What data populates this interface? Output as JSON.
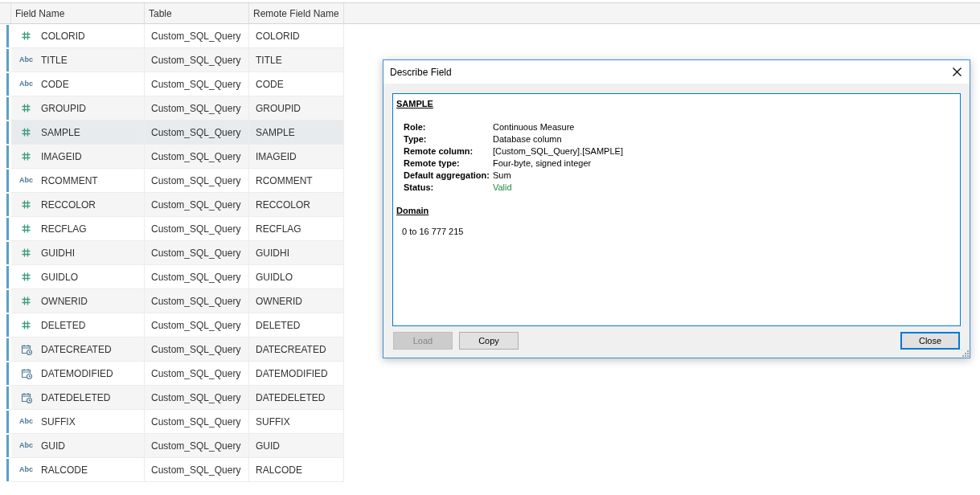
{
  "table": {
    "columns": [
      "Field Name",
      "Table",
      "Remote Field Name"
    ],
    "rows": [
      {
        "kind": "number",
        "name": "COLORID",
        "table": "Custom_SQL_Query",
        "remote": "COLORID",
        "selected": false
      },
      {
        "kind": "string",
        "type_label": "Abc",
        "name": "TITLE",
        "table": "Custom_SQL_Query",
        "remote": "TITLE",
        "selected": false
      },
      {
        "kind": "string",
        "type_label": "Abc",
        "name": "CODE",
        "table": "Custom_SQL_Query",
        "remote": "CODE",
        "selected": false
      },
      {
        "kind": "number",
        "name": "GROUPID",
        "table": "Custom_SQL_Query",
        "remote": "GROUPID",
        "selected": false
      },
      {
        "kind": "number",
        "name": "SAMPLE",
        "table": "Custom_SQL_Query",
        "remote": "SAMPLE",
        "selected": true
      },
      {
        "kind": "number",
        "name": "IMAGEID",
        "table": "Custom_SQL_Query",
        "remote": "IMAGEID",
        "selected": false
      },
      {
        "kind": "string",
        "type_label": "Abc",
        "name": "RCOMMENT",
        "table": "Custom_SQL_Query",
        "remote": "RCOMMENT",
        "selected": false
      },
      {
        "kind": "number",
        "name": "RECCOLOR",
        "table": "Custom_SQL_Query",
        "remote": "RECCOLOR",
        "selected": false
      },
      {
        "kind": "number",
        "name": "RECFLAG",
        "table": "Custom_SQL_Query",
        "remote": "RECFLAG",
        "selected": false
      },
      {
        "kind": "number",
        "name": "GUIDHI",
        "table": "Custom_SQL_Query",
        "remote": "GUIDHI",
        "selected": false
      },
      {
        "kind": "number",
        "name": "GUIDLO",
        "table": "Custom_SQL_Query",
        "remote": "GUIDLO",
        "selected": false
      },
      {
        "kind": "number",
        "name": "OWNERID",
        "table": "Custom_SQL_Query",
        "remote": "OWNERID",
        "selected": false
      },
      {
        "kind": "number",
        "name": "DELETED",
        "table": "Custom_SQL_Query",
        "remote": "DELETED",
        "selected": false
      },
      {
        "kind": "date",
        "name": "DATECREATED",
        "table": "Custom_SQL_Query",
        "remote": "DATECREATED",
        "selected": false
      },
      {
        "kind": "date",
        "name": "DATEMODIFIED",
        "table": "Custom_SQL_Query",
        "remote": "DATEMODIFIED",
        "selected": false
      },
      {
        "kind": "date",
        "name": "DATEDELETED",
        "table": "Custom_SQL_Query",
        "remote": "DATEDELETED",
        "selected": false
      },
      {
        "kind": "string",
        "type_label": "Abc",
        "name": "SUFFIX",
        "table": "Custom_SQL_Query",
        "remote": "SUFFIX",
        "selected": false
      },
      {
        "kind": "string",
        "type_label": "Abc",
        "name": "GUID",
        "table": "Custom_SQL_Query",
        "remote": "GUID",
        "selected": false
      },
      {
        "kind": "string",
        "type_label": "Abc",
        "name": "RALCODE",
        "table": "Custom_SQL_Query",
        "remote": "RALCODE",
        "selected": false
      }
    ]
  },
  "dialog": {
    "title": "Describe Field",
    "heading": "SAMPLE",
    "properties": [
      {
        "label": "Role:",
        "value": "Continuous Measure",
        "kind": "plain"
      },
      {
        "label": "Type:",
        "value": "Database column",
        "kind": "plain"
      },
      {
        "label": "Remote column:",
        "value": "[Custom_SQL_Query].[SAMPLE]",
        "kind": "plain"
      },
      {
        "label": "Remote type:",
        "value": "Four-byte, signed integer",
        "kind": "plain"
      },
      {
        "label": "Default aggregation:",
        "value": "Sum",
        "kind": "plain"
      },
      {
        "label": "Status:",
        "value": "Valid",
        "kind": "status"
      }
    ],
    "domain_heading": "Domain",
    "domain": "0 to 16 777 215",
    "buttons": [
      {
        "label": "Load",
        "disabled": true,
        "default": false
      },
      {
        "label": "Copy",
        "disabled": false,
        "default": false
      },
      {
        "label": "Close",
        "disabled": false,
        "default": true
      }
    ]
  }
}
